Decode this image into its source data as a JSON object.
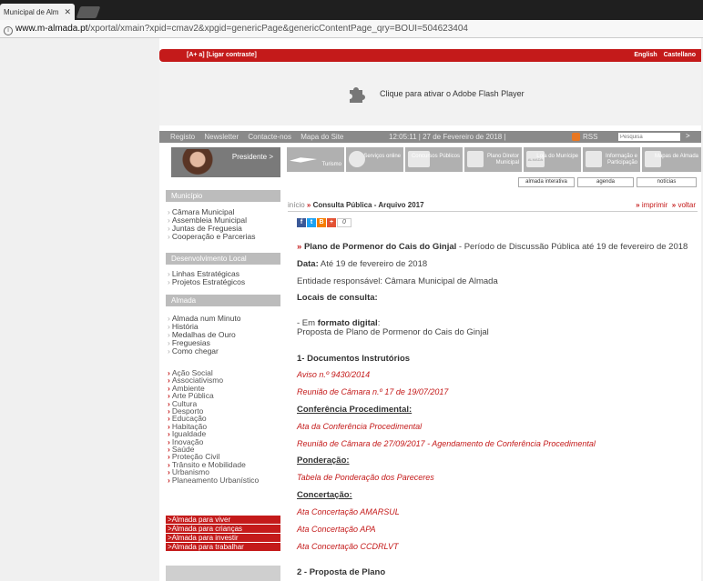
{
  "browser": {
    "tab_title": "Municipal de Alm",
    "url_host": "www.m-almada.pt",
    "url_path": "/xportal/xmain?xpid=cmav2&xpgid=genericPage&genericContentPage_qry=BOUI=504623404"
  },
  "topbar": {
    "accessibility": "[A+ a] [Ligar contraste]",
    "lang_english": "English",
    "lang_castellano": "Castellano"
  },
  "flash": {
    "text": "Clique para ativar o Adobe Flash Player"
  },
  "nav": {
    "links": [
      "Registo",
      "Newsletter",
      "Contacte-nos",
      "Mapa do Site"
    ],
    "datetime": "12:05:11 | 27 de Fevereiro de 2018 |",
    "rss": "RSS",
    "search_placeholder": "Pesquisa",
    "search_go": ">"
  },
  "president": {
    "label": "Presidente >"
  },
  "icon_menu": [
    {
      "label": "Turismo"
    },
    {
      "label": "Serviços online"
    },
    {
      "label": "Concursos Públicos"
    },
    {
      "label": "Plano Diretor Municipal"
    },
    {
      "label": "Loja do Munícipe"
    },
    {
      "label": "Informação e Participação"
    },
    {
      "label": "Mapas de Almada"
    }
  ],
  "icon_menu_logo": "ALMADA",
  "sub_tabs": [
    "almada interativa",
    "agenda",
    "notícias"
  ],
  "sidebar": {
    "municipio": {
      "header": "Município",
      "items": [
        "Câmara Municipal",
        "Assembleia Municipal",
        "Juntas de Freguesia",
        "Cooperação e Parcerias"
      ]
    },
    "desenvolvimento": {
      "header": "Desenvolvimento Local",
      "items": [
        "Linhas Estratégicas",
        "Projetos Estratégicos"
      ]
    },
    "almada": {
      "header": "Almada",
      "items": [
        "Almada num Minuto",
        "História",
        "Medalhas de Ouro",
        "Freguesias",
        "Como chegar"
      ]
    },
    "areas": [
      "Ação Social",
      "Associativismo",
      "Ambiente",
      "Arte Pública",
      "Cultura",
      "Desporto",
      "Educação",
      "Habitação",
      "Igualdade",
      "Inovação",
      "Saúde",
      "Proteção Civil",
      "Trânsito e Mobilidade",
      "Urbanismo",
      "Planeamento Urbanístico"
    ],
    "red_links": [
      ">Almada para viver",
      ">Almada para crianças",
      ">Almada para investir",
      ">Almada para trabalhar"
    ]
  },
  "breadcrumb": {
    "home": "início",
    "sep": "»",
    "current": "Consulta Pública - Arquivo 2017",
    "print": "imprimir",
    "back": "voltar"
  },
  "share": {
    "count": "0"
  },
  "content": {
    "title_bold": "Plano de Pormenor do Cais do Ginjal",
    "title_rest": " - Período de Discussão Pública até 19 de fevereiro de 2018",
    "data_label": "Data:",
    "data_value": " Até 19 de fevereiro de 2018",
    "entidade": "Entidade responsável: Câmara Municipal de Almada",
    "locais": "Locais de consulta:",
    "formato_prefix": "- Em ",
    "formato_bold": "formato digital",
    "formato_suffix": ":",
    "proposta_line": "Proposta de Plano de Pormenor do Cais do Ginjal",
    "sec1": "1- Documentos Instrutórios",
    "aviso": "Aviso n.º 9430/2014",
    "reuniao1": "Reunião de Câmara n.º 17 de 19/07/2017",
    "conf_title": "Conferência Procedimental:",
    "conf_ata": "Ata da Conferência Procedimental",
    "conf_reuniao": "Reunião de Câmara de 27/09/2017 - Agendamento de Conferência Procedimental",
    "pond_title": "Ponderação:",
    "pond_tab": "Tabela de Ponderação dos Pareceres",
    "conc_title": "Concertação:",
    "conc1": "Ata Concertação AMARSUL",
    "conc2": "Ata Concertação APA",
    "conc3": "Ata Concertação CCDRLVT",
    "sec2": "2 - Proposta de Plano"
  }
}
